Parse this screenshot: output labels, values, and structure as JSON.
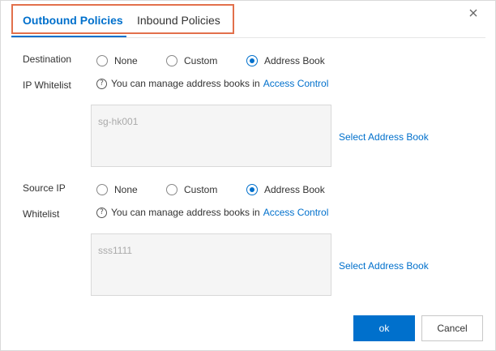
{
  "tabs": {
    "outbound_label": "Outbound Policies",
    "inbound_label": "Inbound Policies"
  },
  "destination": {
    "label": "Destination",
    "sublabel": "IP Whitelist",
    "options": [
      "None",
      "Custom",
      "Address Book"
    ],
    "selected": "Address Book",
    "hint_text": "You can manage address books in",
    "hint_link": "Access Control",
    "value": "sg-hk001",
    "select_link": "Select Address Book"
  },
  "source": {
    "label": "Source IP",
    "sublabel": "Whitelist",
    "options": [
      "None",
      "Custom",
      "Address Book"
    ],
    "selected": "Address Book",
    "hint_text": "You can manage address books in",
    "hint_link": "Access Control",
    "value": "sss1111",
    "select_link": "Select Address Book"
  },
  "buttons": {
    "ok": "ok",
    "cancel": "Cancel"
  },
  "icons": {
    "close": "close-icon",
    "help": "question-circle-icon"
  },
  "colors": {
    "accent": "#0070cc",
    "highlight_border": "#e2704b"
  }
}
